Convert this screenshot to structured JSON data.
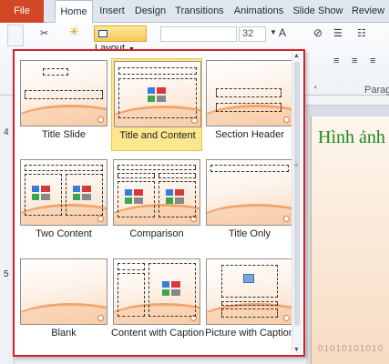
{
  "ribbon": {
    "tabs": [
      "File",
      "Home",
      "Insert",
      "Design",
      "Transitions",
      "Animations",
      "Slide Show",
      "Review"
    ],
    "layout_button_label": "Layout",
    "font_size_value": "32",
    "paragraph_group_label": "Parag"
  },
  "left_pane": {
    "slide_numbers": [
      "4",
      "5"
    ]
  },
  "slide_preview": {
    "title_text": "Hình ảnh",
    "footer_bits": "01010101010"
  },
  "layout_gallery": {
    "selected": "Title and Content",
    "layouts": [
      {
        "label": "Title Slide"
      },
      {
        "label": "Title and Content"
      },
      {
        "label": "Section Header"
      },
      {
        "label": "Two Content"
      },
      {
        "label": "Comparison"
      },
      {
        "label": "Title Only"
      },
      {
        "label": "Blank"
      },
      {
        "label": "Content with Caption"
      },
      {
        "label": "Picture with Caption"
      }
    ]
  },
  "colors": {
    "file_tab": "#d24726",
    "selection_highlight": "#fce68f",
    "gallery_border": "#d2232a",
    "slide_title": "#1a8a1a"
  }
}
